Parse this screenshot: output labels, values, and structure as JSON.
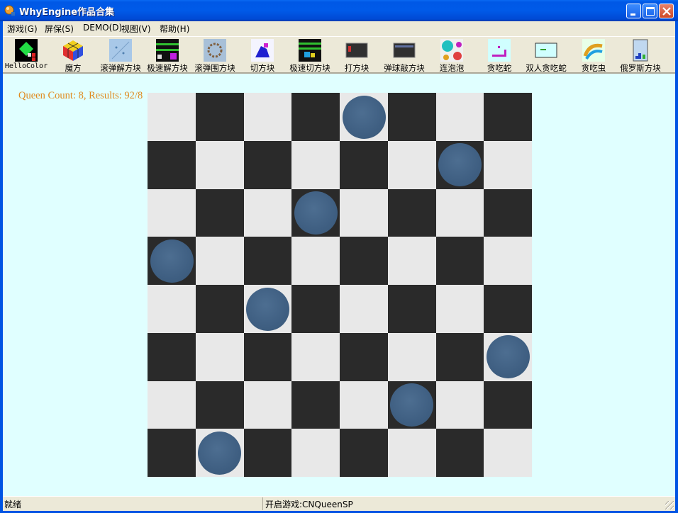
{
  "window": {
    "title": "WhyEngine作品合集"
  },
  "menu": [
    {
      "label": "游戏(G)"
    },
    {
      "label": "屏保(S)"
    },
    {
      "label": "DEMO(D)"
    },
    {
      "label": "视图(V)"
    },
    {
      "label": "帮助(H)"
    }
  ],
  "toolbar": [
    {
      "label": "HelloColor",
      "icon": "hellocolor-icon"
    },
    {
      "label": "魔方",
      "icon": "rubiks-cube-icon"
    },
    {
      "label": "滚弹解方块",
      "icon": "bounce-solve-blocks-icon"
    },
    {
      "label": "极速解方块",
      "icon": "speed-solve-blocks-icon"
    },
    {
      "label": "滚弹围方块",
      "icon": "bounce-surround-blocks-icon"
    },
    {
      "label": "切方块",
      "icon": "cut-blocks-icon"
    },
    {
      "label": "极速切方块",
      "icon": "speed-cut-blocks-icon"
    },
    {
      "label": "打方块",
      "icon": "hit-blocks-icon"
    },
    {
      "label": "弹球敲方块",
      "icon": "pinball-blocks-icon"
    },
    {
      "label": "连泡泡",
      "icon": "bubbles-icon"
    },
    {
      "label": "贪吃蛇",
      "icon": "snake-icon"
    },
    {
      "label": "双人贪吃蛇",
      "icon": "two-player-snake-icon"
    },
    {
      "label": "贪吃虫",
      "icon": "worm-icon"
    },
    {
      "label": "俄罗斯方块",
      "icon": "tetris-icon"
    }
  ],
  "game": {
    "status_text": "Queen Count: 8, Results: 92/8",
    "board_size": 8,
    "queen_columns_by_row": [
      4,
      6,
      3,
      0,
      2,
      7,
      5,
      1
    ],
    "colors": {
      "light": "#e8e8e8",
      "dark": "#2a2a2a",
      "queen": "#3f5f82",
      "status_text": "#e08a1e",
      "background": "#e0ffff"
    }
  },
  "status": {
    "left": "就绪",
    "right": "开启游戏:CNQueenSP"
  }
}
